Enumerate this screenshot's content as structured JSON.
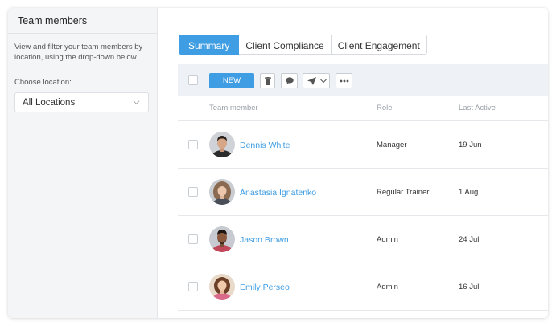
{
  "sidebar": {
    "title": "Team members",
    "description": "View and filter your team members by location, using the drop-down below.",
    "location_label": "Choose location:",
    "location_value": "All Locations"
  },
  "tabs": [
    {
      "label": "Summary",
      "active": true
    },
    {
      "label": "Client Compliance",
      "active": false
    },
    {
      "label": "Client Engagement",
      "active": false
    }
  ],
  "toolbar": {
    "new_label": "NEW",
    "icons": [
      "trash-icon",
      "comment-icon",
      "send-icon",
      "more-icon"
    ]
  },
  "table": {
    "headers": [
      "Team member",
      "Role",
      "Last Active"
    ],
    "rows": [
      {
        "name": "Dennis White",
        "role": "Manager",
        "last_active": "19 Jun"
      },
      {
        "name": "Anastasia Ignatenko",
        "role": "Regular Trainer",
        "last_active": "1 Aug"
      },
      {
        "name": "Jason Brown",
        "role": "Admin",
        "last_active": "24 Jul"
      },
      {
        "name": "Emily Perseo",
        "role": "Admin",
        "last_active": "16 Jul"
      }
    ]
  },
  "colors": {
    "accent": "#3f9de3",
    "sidebar_bg": "#f4f5f7",
    "toolbar_bg": "#eef2f6"
  }
}
